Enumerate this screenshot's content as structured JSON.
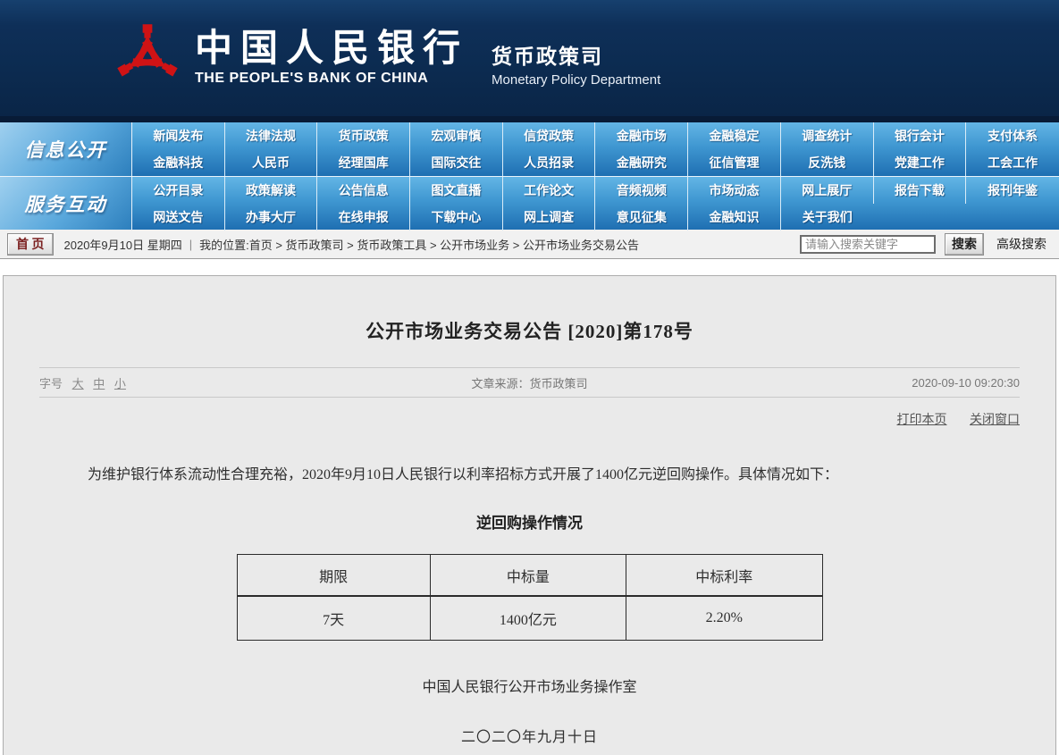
{
  "header": {
    "bank_name_cn": "中国人民银行",
    "bank_name_en": "THE PEOPLE'S BANK OF CHINA",
    "dept_cn": "货币政策司",
    "dept_en": "Monetary Policy Department"
  },
  "colors": {
    "header_navy": "#0c2b50",
    "nav_blue_top": "#63b5e5",
    "nav_blue_bottom": "#1f6fb2",
    "logo_red": "#cf1315",
    "panel_bg": "#eaeaea"
  },
  "nav": {
    "sections": [
      {
        "label": "信息公开",
        "row1": [
          "新闻发布",
          "法律法规",
          "货币政策",
          "宏观审慎",
          "信贷政策",
          "金融市场",
          "金融稳定",
          "调查统计",
          "银行会计",
          "支付体系"
        ],
        "row2": [
          "金融科技",
          "人民币",
          "经理国库",
          "国际交往",
          "人员招录",
          "金融研究",
          "征信管理",
          "反洗钱",
          "党建工作",
          "工会工作"
        ]
      },
      {
        "label": "服务互动",
        "row1": [
          "公开目录",
          "政策解读",
          "公告信息",
          "图文直播",
          "工作论文",
          "音频视频",
          "市场动态",
          "网上展厅",
          "报告下载",
          "报刊年鉴"
        ],
        "row2": [
          "网送文告",
          "办事大厅",
          "在线申报",
          "下载中心",
          "网上调查",
          "意见征集",
          "金融知识",
          "关于我们"
        ]
      }
    ]
  },
  "toolbar": {
    "home_button": "首 页",
    "date_line": "2020年9月10日  星期四",
    "separator": "|",
    "breadcrumb": "我的位置:首页 > 货币政策司 > 货币政策工具 > 公开市场业务 > 公开市场业务交易公告",
    "search_placeholder": "请输入搜索关键字",
    "search_button": "搜索",
    "advanced_search": "高级搜索"
  },
  "article": {
    "title": "公开市场业务交易公告  [2020]第178号",
    "font_size_label": "字号",
    "font_sizes": [
      "大",
      "中",
      "小"
    ],
    "source_line": "文章来源：货币政策司",
    "datetime": "2020-09-10 09:20:30",
    "print_link": "打印本页",
    "close_link": "关闭窗口",
    "paragraph": "为维护银行体系流动性合理充裕，2020年9月10日人民银行以利率招标方式开展了1400亿元逆回购操作。具体情况如下：",
    "table_title": "逆回购操作情况",
    "table": {
      "headers": [
        "期限",
        "中标量",
        "中标利率"
      ],
      "rows": [
        [
          "7天",
          "1400亿元",
          "2.20%"
        ]
      ]
    },
    "signature": "中国人民银行公开市场业务操作室",
    "sign_date": "二〇二〇年九月十日"
  }
}
